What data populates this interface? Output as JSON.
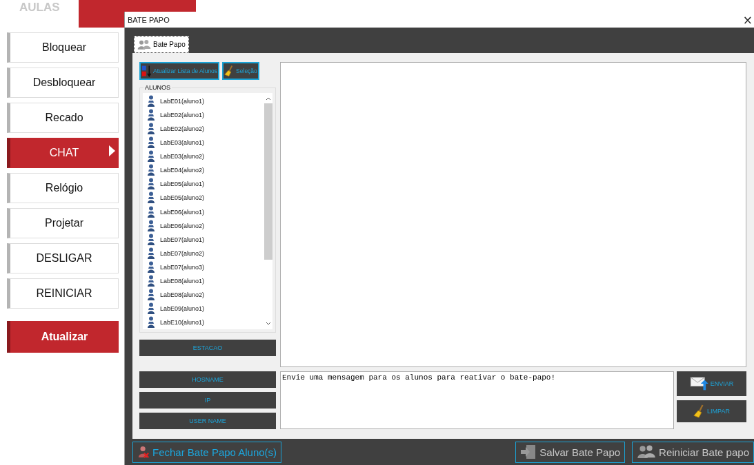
{
  "app_header": {
    "section_label": "AULAS"
  },
  "sidebar": {
    "items": [
      {
        "label": "Bloquear",
        "selected": false
      },
      {
        "label": "Desbloquear",
        "selected": false
      },
      {
        "label": "Recado",
        "selected": false
      },
      {
        "label": "CHAT",
        "selected": true
      },
      {
        "label": "Relógio",
        "selected": false
      },
      {
        "label": "Projetar",
        "selected": false
      },
      {
        "label": "DESLIGAR",
        "selected": false
      },
      {
        "label": "REINICIAR",
        "selected": false
      }
    ],
    "refresh_button": "Atualizar"
  },
  "window": {
    "title": "BATE PAPO",
    "close": "×"
  },
  "tabs": [
    {
      "label": "Bate Papo",
      "selected": true
    }
  ],
  "toolbar": {
    "buttons": [
      {
        "kind": "sort",
        "label": "Atualizar Lista de Alunos"
      },
      {
        "kind": "broom",
        "label": "Seleção"
      }
    ]
  },
  "students": {
    "title": "ALUNOS",
    "items": [
      "LabE01(aluno1)",
      "LabE02(aluno1)",
      "LabE02(aluno2)",
      "LabE03(aluno1)",
      "LabE03(aluno2)",
      "LabE04(aluno2)",
      "LabE05(aluno1)",
      "LabE05(aluno2)",
      "LabE06(aluno1)",
      "LabE06(aluno2)",
      "LabE07(aluno1)",
      "LabE07(aluno2)",
      "LabE07(aluno3)",
      "LabE08(aluno1)",
      "LabE08(aluno2)",
      "LabE09(aluno1)",
      "LabE10(aluno1)"
    ]
  },
  "info_fields": [
    "ESTACAO",
    "HOSNAME",
    "IP",
    "USER NAME"
  ],
  "message": {
    "value": "Envie uma mensagem para os alunos para reativar o bate-papo!"
  },
  "message_buttons": [
    {
      "kind": "send",
      "label": "ENVIAR"
    },
    {
      "kind": "broom",
      "label": "LIMPAR"
    }
  ],
  "footer": {
    "buttons": [
      {
        "kind": "close-chat",
        "label": "Fechar Bate Papo Aluno(s)",
        "disabled": false
      },
      {
        "kind": "save",
        "label": "Salvar Bate Papo",
        "disabled": true
      },
      {
        "kind": "restart",
        "label": "Reiniciar Bate papo",
        "disabled": true
      }
    ]
  }
}
